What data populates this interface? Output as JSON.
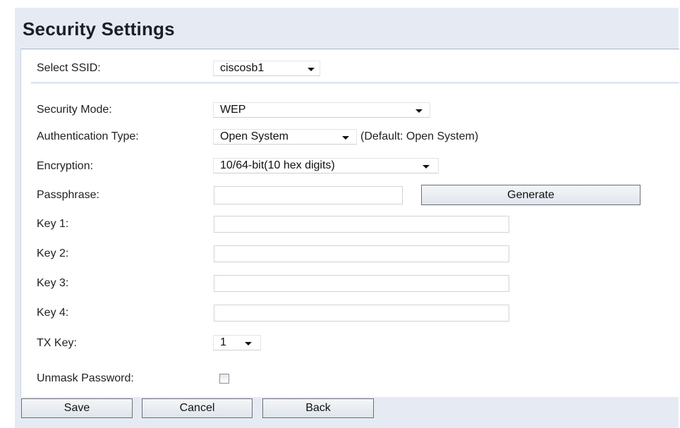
{
  "page": {
    "title": "Security Settings"
  },
  "ssid": {
    "label": "Select SSID:",
    "value": "ciscosb1"
  },
  "security_mode": {
    "label": "Security Mode:",
    "value": "WEP"
  },
  "authentication_type": {
    "label": "Authentication Type:",
    "value": "Open System",
    "hint": "(Default: Open System)"
  },
  "encryption": {
    "label": "Encryption:",
    "value": "10/64-bit(10 hex digits)"
  },
  "passphrase": {
    "label": "Passphrase:",
    "value": "",
    "generate_label": "Generate"
  },
  "keys": [
    {
      "label": "Key 1:",
      "value": ""
    },
    {
      "label": "Key 2:",
      "value": ""
    },
    {
      "label": "Key 3:",
      "value": ""
    },
    {
      "label": "Key 4:",
      "value": ""
    }
  ],
  "tx_key": {
    "label": "TX Key:",
    "value": "1"
  },
  "unmask_password": {
    "label": "Unmask Password:",
    "checked": false
  },
  "actions": {
    "save_label": "Save",
    "cancel_label": "Cancel",
    "back_label": "Back"
  },
  "colors": {
    "frame_background": "#e6ebf3",
    "divider": "#b9c4e6",
    "button_gradient_top": "#f4f6f8",
    "button_gradient_bottom": "#dfe5ec"
  },
  "icons": {
    "dropdown": "chevron-down-icon",
    "checkbox": "checkbox-unchecked"
  }
}
